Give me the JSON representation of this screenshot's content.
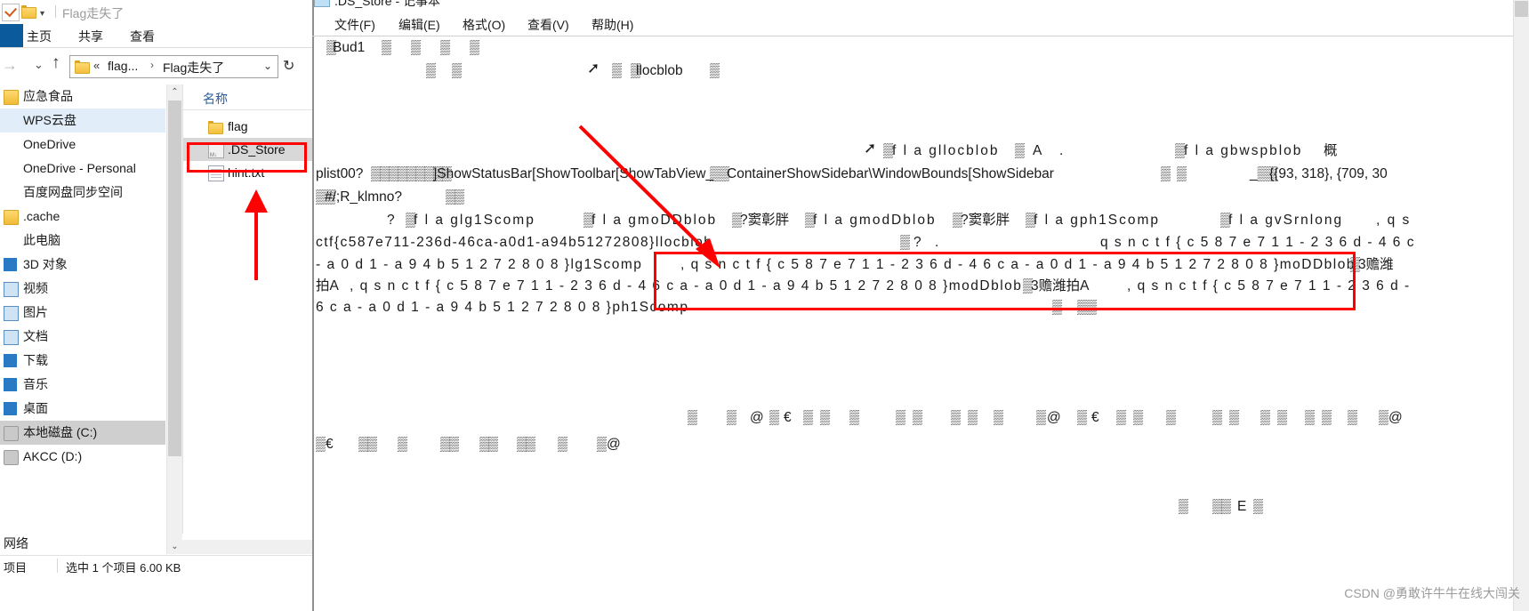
{
  "explorer": {
    "title": "Flag走失了",
    "quick_access": {
      "check_icon": "checkmark-icon",
      "folder_icon": "folder-icon",
      "dropdown_caret": "▾"
    },
    "ribbon_tabs": [
      {
        "label": "主页"
      },
      {
        "label": "共享"
      },
      {
        "label": "查看"
      }
    ],
    "address": {
      "forward_icon": "→",
      "recent_icon": "⌄",
      "up_icon": "↑",
      "folder_icon": "folder-icon",
      "chevron": "«",
      "crumb1": "flag...",
      "separator": "›",
      "crumb2": "Flag走失了",
      "dropdown": "⌄",
      "refresh": "↻"
    },
    "nav_items": [
      {
        "label": "应急食品",
        "icon": "folder-icon",
        "state": "normal"
      },
      {
        "label": "WPS云盘",
        "icon": "none",
        "state": "selected"
      },
      {
        "label": "OneDrive",
        "icon": "none",
        "state": "normal"
      },
      {
        "label": "OneDrive - Personal",
        "icon": "none",
        "state": "normal"
      },
      {
        "label": "百度网盘同步空间",
        "icon": "none",
        "state": "normal"
      },
      {
        "label": ".cache",
        "icon": "folder-icon",
        "state": "normal"
      },
      {
        "label": "此电脑",
        "icon": "none",
        "state": "normal"
      },
      {
        "label": "3D 对象",
        "icon": "blue-icon",
        "state": "normal"
      },
      {
        "label": "视频",
        "icon": "box-icon",
        "state": "normal"
      },
      {
        "label": "图片",
        "icon": "box-icon",
        "state": "normal"
      },
      {
        "label": "文档",
        "icon": "box-icon",
        "state": "normal"
      },
      {
        "label": "下载",
        "icon": "blue-icon",
        "state": "normal"
      },
      {
        "label": "音乐",
        "icon": "blue-icon",
        "state": "normal"
      },
      {
        "label": "桌面",
        "icon": "blue-icon",
        "state": "normal"
      },
      {
        "label": "本地磁盘 (C:)",
        "icon": "disk-icon",
        "state": "selected2"
      },
      {
        "label": "AKCC (D:)",
        "icon": "disk-icon",
        "state": "normal"
      }
    ],
    "network_label": "网络",
    "column_header": "名称",
    "files": [
      {
        "name": "flag",
        "icon": "folder-icon",
        "selected": false
      },
      {
        "name": ".DS_Store",
        "icon": "ds-file-icon",
        "selected": true
      },
      {
        "name": "hint.txt",
        "icon": "text-file-icon",
        "selected": false
      }
    ],
    "status": {
      "count": "项目",
      "selection": "选中 1 个项目  6.00 KB"
    },
    "scroll": {
      "up": "⌃",
      "down": "⌄"
    }
  },
  "notepad": {
    "title": ".DS_Store - 记事本",
    "menus": [
      {
        "label": "文件(F)"
      },
      {
        "label": "编辑(E)"
      },
      {
        "label": "格式(O)"
      },
      {
        "label": "查看(V)"
      },
      {
        "label": "帮助(H)"
      }
    ],
    "lines": {
      "l1": "Bud1",
      "l1b": "",
      "l2": "",
      "l2_right": "llocblob",
      "l3_right1": "f l a gllocblob",
      "l3_right2": "A",
      "l3_right3": ".",
      "l3_right4": "f l a gbwspblob",
      "l3_right5": "概",
      "l4": "plist00?",
      "l4b": "]ShowStatusBar[ShowToolbar[ShowTabView_",
      "l4c": "ContainerShowSidebar\\WindowBounds[ShowSidebar",
      "l4d": "{{93, 318}, {709, 30",
      "l5": "#/;R_klmno?",
      "l6a": "?",
      "l6b": "f l a glg1Scomp",
      "l6c": "f l a gmoDDblob",
      "l6d": "?窦彰胖",
      "l6e": "f l a gmodDblob",
      "l6f": "?窦彰胖",
      "l6g": "f l a gph1Scomp",
      "l6h": "f l a gvSrnlong",
      "l6i": ", q s",
      "l7a": "ctf{c587e711-236d-46ca-a0d1-a94b51272808}llocblob",
      "l7b": "?",
      "l7c": ".",
      "l7d": "q s n c t f { c 5 8 7 e 7 1 1 - 2 3 6 d - 4 6 c",
      "l8a": "- a 0 d 1 - a 9 4 b 5 1 2 7 2 8 0 8 }lg1Scomp",
      "l8b": ", q s n c t f { c 5 8 7 e 7 1 1 - 2 3 6 d - 4 6 c a - a 0 d 1 - a 9 4 b 5 1 2 7 2 8 0 8 }moDDblob",
      "l8c": "3赡潍",
      "l9a": "拍A",
      "l9b": ", q s n c t f { c 5 8 7 e 7 1 1 - 2 3 6 d - 4 6 c a - a 0 d 1 - a 9 4 b 5 1 2 7 2 8 0 8 }modDblob",
      "l9c": "3赡潍拍A",
      "l9d": ", q s n c t f { c 5 8 7 e 7 1 1 - 2 3 6 d -",
      "l10a": "6 c a - a 0 d 1 - a 9 4 b 5 1 2 7 2 8 0 8 }ph1Scomp"
    },
    "flag_value": "qsnctf{c587e711-236d-46ca-a0d1-a94b51272808}"
  },
  "annotations": {
    "red_box_file": "highlight-ds-store-file",
    "red_box_flag": "highlight-flag-text",
    "arrow_up": "arrow-pointing-to-ds-store",
    "arrow_diagonal": "arrow-pointing-to-flag-text"
  },
  "watermark": "CSDN @勇敢许牛牛在线大闯关"
}
